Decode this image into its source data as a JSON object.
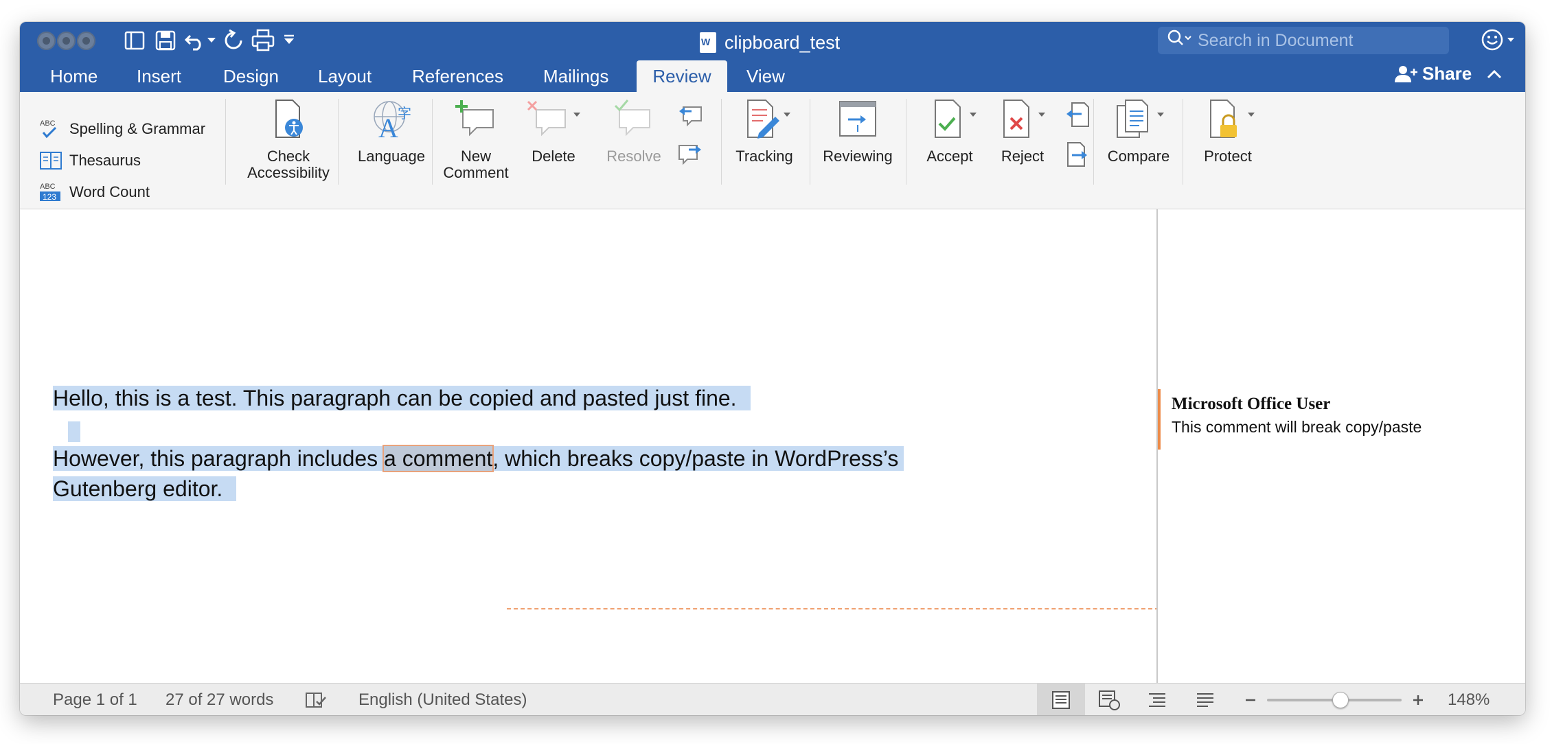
{
  "window": {
    "title": "clipboard_test"
  },
  "search": {
    "placeholder": "Search in Document"
  },
  "tabs": [
    {
      "label": "Home"
    },
    {
      "label": "Insert"
    },
    {
      "label": "Design"
    },
    {
      "label": "Layout"
    },
    {
      "label": "References"
    },
    {
      "label": "Mailings"
    },
    {
      "label": "Review"
    },
    {
      "label": "View"
    }
  ],
  "active_tab": "Review",
  "share_label": "Share",
  "proofing": [
    {
      "label": "Spelling & Grammar",
      "icon": "spelling-icon"
    },
    {
      "label": "Thesaurus",
      "icon": "thesaurus-icon"
    },
    {
      "label": "Word Count",
      "icon": "word-count-icon"
    }
  ],
  "ribbon": {
    "check_accessibility": [
      "Check",
      "Accessibility"
    ],
    "language": "Language",
    "new_comment": [
      "New",
      "Comment"
    ],
    "delete": "Delete",
    "resolve": "Resolve",
    "tracking": "Tracking",
    "reviewing": "Reviewing",
    "accept": "Accept",
    "reject": "Reject",
    "compare": "Compare",
    "protect": "Protect"
  },
  "document": {
    "para1": "Hello, this is a test. This paragraph can be copied and pasted just fine.",
    "para2_before": "However, this paragraph includes ",
    "para2_commented": "a comment",
    "para2_after": ", which breaks copy/paste in WordPress’s",
    "para2_line2": "Gutenberg editor."
  },
  "comment": {
    "author": "Microsoft Office User",
    "text": "This comment will break copy/paste"
  },
  "status": {
    "page": "Page 1 of 1",
    "words": "27 of 27 words",
    "language": "English (United States)",
    "zoom": "148%",
    "zoom_percent": 148
  },
  "colors": {
    "titlebar": "#2c5ea9",
    "selection": "#c6dbf3",
    "comment_accent": "#ed8a47"
  }
}
